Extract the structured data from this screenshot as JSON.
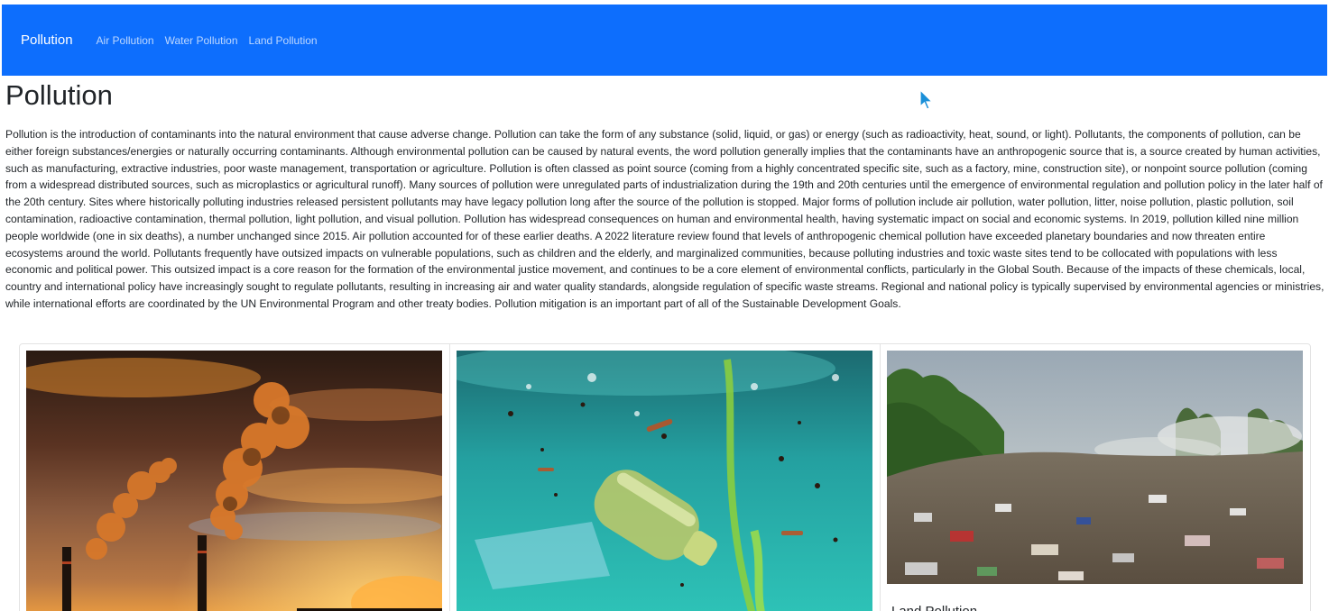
{
  "navbar": {
    "brand": "Pollution",
    "links": [
      "Air Pollution",
      "Water Pollution",
      "Land Pollution"
    ],
    "background_color": "#0d6efd"
  },
  "main": {
    "title": "Pollution",
    "paragraph": "Pollution is the introduction of contaminants into the natural environment that cause adverse change. Pollution can take the form of any substance (solid, liquid, or gas) or energy (such as radioactivity, heat, sound, or light). Pollutants, the components of pollution, can be either foreign substances/energies or naturally occurring contaminants. Although environmental pollution can be caused by natural events, the word pollution generally implies that the contaminants have an anthropogenic source that is, a source created by human activities, such as manufacturing, extractive industries, poor waste management, transportation or agriculture. Pollution is often classed as point source (coming from a highly concentrated specific site, such as a factory, mine, construction site), or nonpoint source pollution (coming from a widespread distributed sources, such as microplastics or agricultural runoff). Many sources of pollution were unregulated parts of industrialization during the 19th and 20th centuries until the emergence of environmental regulation and pollution policy in the later half of the 20th century. Sites where historically polluting industries released persistent pollutants may have legacy pollution long after the source of the pollution is stopped. Major forms of pollution include air pollution, water pollution, litter, noise pollution, plastic pollution, soil contamination, radioactive contamination, thermal pollution, light pollution, and visual pollution. Pollution has widespread consequences on human and environmental health, having systematic impact on social and economic systems. In 2019, pollution killed nine million people worldwide (one in six deaths), a number unchanged since 2015. Air pollution accounted for of these earlier deaths. A 2022 literature review found that levels of anthropogenic chemical pollution have exceeded planetary boundaries and now threaten entire ecosystems around the world. Pollutants frequently have outsized impacts on vulnerable populations, such as children and the elderly, and marginalized communities, because polluting industries and toxic waste sites tend to be collocated with populations with less economic and political power. This outsized impact is a core reason for the formation of the environmental justice movement, and continues to be a core element of environmental conflicts, particularly in the Global South. Because of the impacts of these chemicals, local, country and international policy have increasingly sought to regulate pollutants, resulting in increasing air and water quality standards, alongside regulation of specific waste streams. Regional and national policy is typically supervised by environmental agencies or ministries, while international efforts are coordinated by the UN Environmental Program and other treaty bodies. Pollution mitigation is an important part of all of the Sustainable Development Goals."
  },
  "cards": [
    {
      "image": "air-pollution-smokestacks-photo",
      "title": ""
    },
    {
      "image": "water-pollution-plastic-bottle-photo",
      "title": ""
    },
    {
      "image": "land-pollution-garbage-dump-photo",
      "title": "Land Pollution"
    }
  ]
}
